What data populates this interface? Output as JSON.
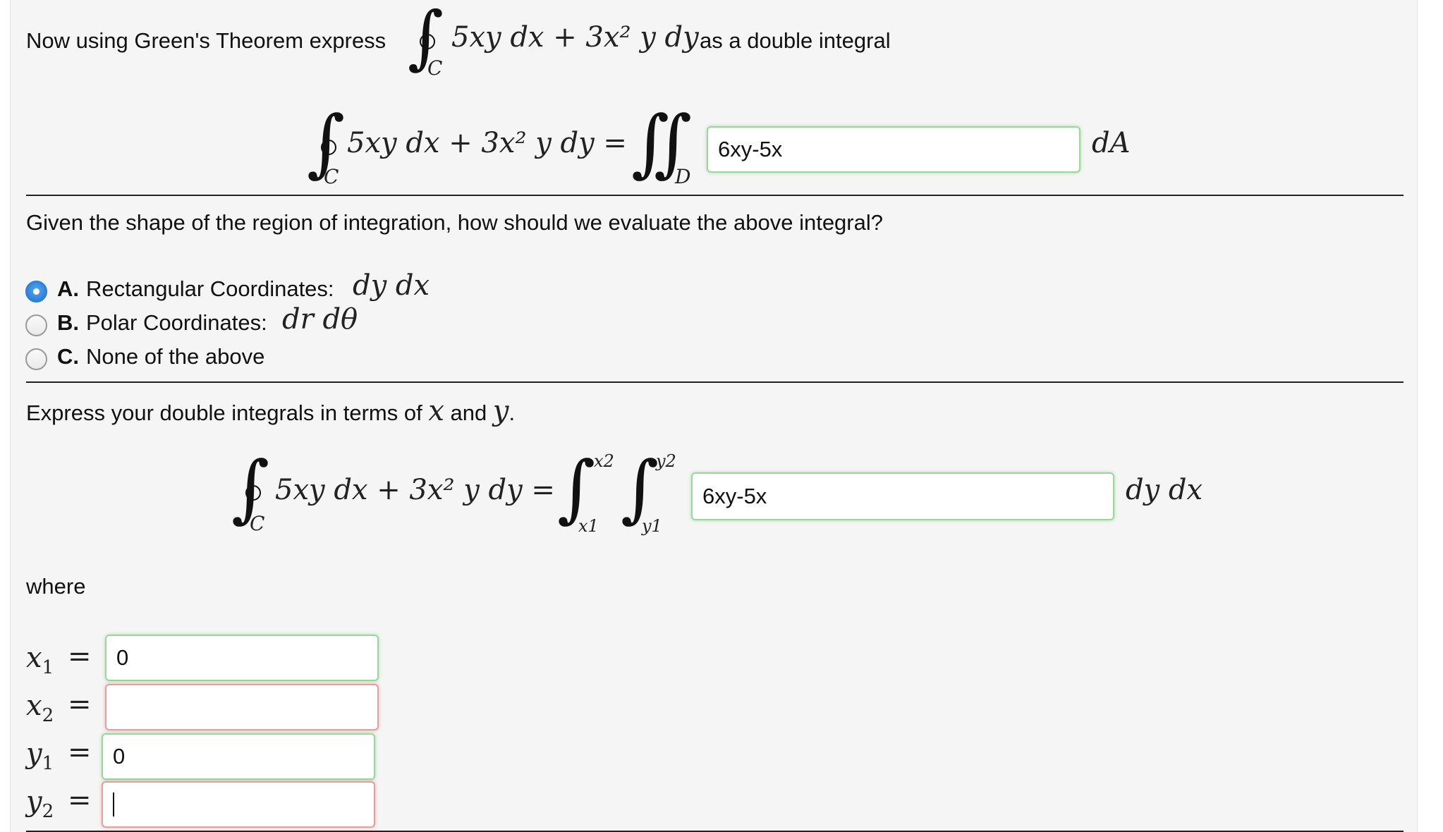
{
  "intro": {
    "prefix": "Now using Green's Theorem express",
    "suffix": "as a double integral"
  },
  "integrand": "5xy dx + 3x² y dy",
  "integrand_eq": "5xy dx + 3x² y dy =",
  "symbols": {
    "contour_sub": "C",
    "region_sub": "D",
    "dA": "dA",
    "dy_dx": "dy  dx",
    "x_upper": "x2",
    "x_lower": "x1",
    "y_upper": "y2",
    "y_lower": "y1"
  },
  "greens_answer": "6xy-5x",
  "question": "Given the shape of the region of integration, how should we evaluate the above integral?",
  "options": [
    {
      "letter": "A.",
      "text": "Rectangular Coordinates:",
      "math": "dy  dx",
      "selected": true
    },
    {
      "letter": "B.",
      "text": "Polar Coordinates:",
      "math": "dr  dθ",
      "selected": false
    },
    {
      "letter": "C.",
      "text": "None of the above",
      "math": "",
      "selected": false
    }
  ],
  "express": {
    "prefix": "Express your double integrals in terms of",
    "x": "x",
    "and": "and",
    "y": "y",
    "period": "."
  },
  "iterated_answer": "6xy-5x",
  "where_label": "where",
  "bounds": [
    {
      "var": "x",
      "sub": "1",
      "eq": "=",
      "value": "0",
      "status": "correct"
    },
    {
      "var": "x",
      "sub": "2",
      "eq": "=",
      "value": "",
      "status": "incorrect"
    },
    {
      "var": "y",
      "sub": "1",
      "eq": "=",
      "value": "0",
      "status": "correct"
    },
    {
      "var": "y",
      "sub": "2",
      "eq": "=",
      "value": "",
      "status": "incorrect"
    }
  ],
  "colors": {
    "correct_border": "#9bd79b",
    "incorrect_border": "#e3a0a0",
    "radio_selected": "#2d7fd6"
  }
}
